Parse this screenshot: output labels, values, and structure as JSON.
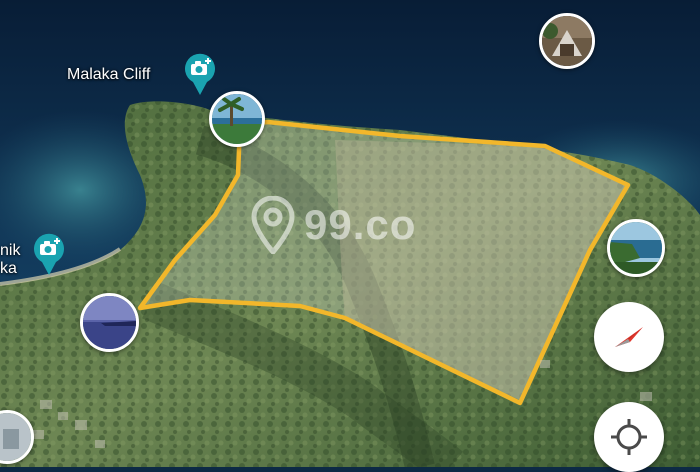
{
  "places": {
    "malaka_cliff": "Malaka Cliff",
    "partial_label_line1": "nik",
    "partial_label_line2": "ka"
  },
  "watermark": "99.co",
  "colors": {
    "boundary": "#f2b72b",
    "pin": "#1aa3b0",
    "sea_deep": "#0d2a45",
    "land": "#5f7d4a"
  },
  "icons": {
    "photo_pin": "camera-pin-icon",
    "compass": "compass-icon",
    "locate": "crosshair-icon"
  }
}
